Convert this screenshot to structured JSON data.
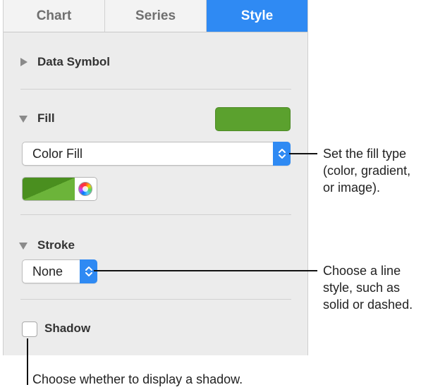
{
  "inspector": {
    "tabs": [
      {
        "label": "Chart",
        "active": false
      },
      {
        "label": "Series",
        "active": false
      },
      {
        "label": "Style",
        "active": true
      }
    ],
    "sections": {
      "data_symbol": {
        "label": "Data Symbol",
        "expanded": false
      },
      "fill": {
        "label": "Fill",
        "expanded": true,
        "swatch_color": "#5ba12e",
        "fill_type_value": "Color Fill",
        "color_well_color": "#4a8f1f"
      },
      "stroke": {
        "label": "Stroke",
        "expanded": true,
        "style_value": "None"
      },
      "shadow": {
        "label": "Shadow",
        "checked": false
      }
    },
    "accent_color": "#2f8af3"
  },
  "callouts": {
    "fill_type": [
      "Set the fill type",
      "(color, gradient,",
      "or image)."
    ],
    "stroke_style": [
      "Choose a line",
      "style, such as",
      "solid or dashed."
    ],
    "shadow": "Choose whether to display a shadow."
  }
}
